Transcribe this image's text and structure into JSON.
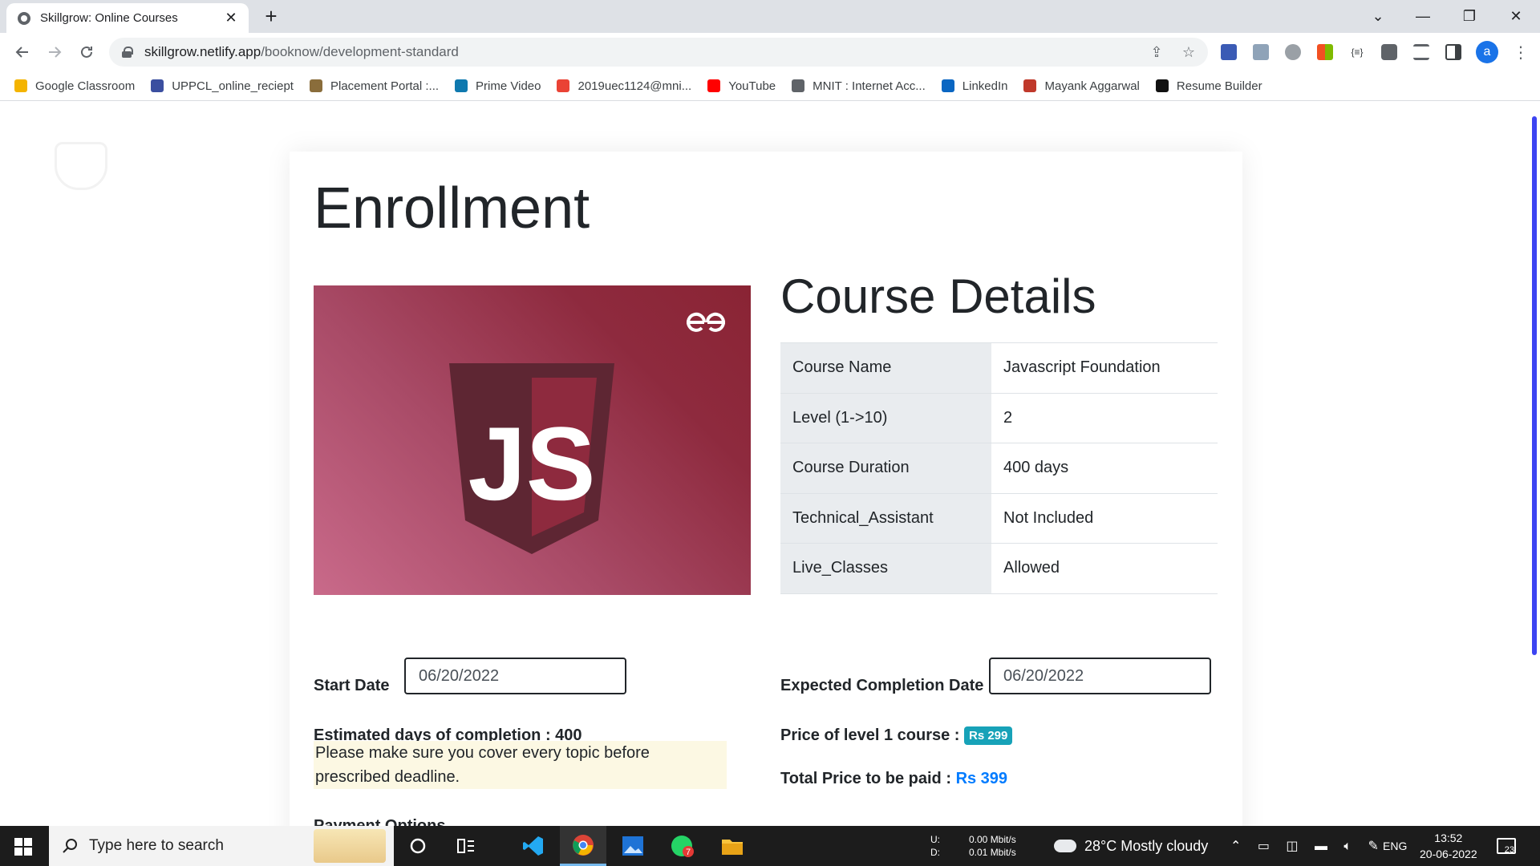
{
  "browser": {
    "tab_title": "Skillgrow: Online Courses",
    "tab_close": "✕",
    "new_tab": "+",
    "url_host": "skillgrow.netlify.app",
    "url_path": "/booknow/development-standard",
    "profile_initial": "a",
    "window_controls": {
      "dropdown": "⌄",
      "minimize": "—",
      "restore": "❐",
      "close": "✕"
    }
  },
  "bookmarks": [
    {
      "label": "Google Classroom",
      "color": "#f4b400"
    },
    {
      "label": "UPPCL_online_reciept",
      "color": "#3b4fa0"
    },
    {
      "label": "Placement Portal :...",
      "color": "#8a6d3b"
    },
    {
      "label": "Prime Video",
      "color": "#0f79af"
    },
    {
      "label": "2019uec1124@mni...",
      "color": "#ea4335"
    },
    {
      "label": "YouTube",
      "color": "#ff0000"
    },
    {
      "label": "MNIT : Internet Acc...",
      "color": "#5f6368"
    },
    {
      "label": "LinkedIn",
      "color": "#0a66c2"
    },
    {
      "label": "Mayank Aggarwal",
      "color": "#c0392b"
    },
    {
      "label": "Resume Builder",
      "color": "#111111"
    }
  ],
  "page": {
    "title": "Enrollment",
    "image_brand": "GfG",
    "image_logo_text": "JS",
    "details_title": "Course Details",
    "details": [
      {
        "key": "Course Name",
        "value": "Javascript Foundation"
      },
      {
        "key": "Level (1->10)",
        "value": "2"
      },
      {
        "key": "Course Duration",
        "value": "400 days"
      },
      {
        "key": "Technical_Assistant",
        "value": "Not Included"
      },
      {
        "key": "Live_Classes",
        "value": "Allowed"
      }
    ],
    "start_date_label": "Start Date",
    "start_date_value": "06/20/2022",
    "completion_label": "Expected Completion Date",
    "completion_value": "06/20/2022",
    "estimated_label": "Estimated days of completion : 400",
    "price_level1_label": "Price of level 1 course :",
    "price_level1_value": "Rs 299",
    "total_label": "Total Price to be paid :",
    "total_value": "Rs 399",
    "notice": "Please make sure you cover every topic before prescribed deadline.",
    "payment_heading": "Payment Options"
  },
  "taskbar": {
    "search_placeholder": "Type here to search",
    "net_up_label": "U:",
    "net_up": "0.00 Mbit/s",
    "net_down_label": "D:",
    "net_down": "0.01 Mbit/s",
    "weather": "28°C  Mostly cloudy",
    "lang": "ENG",
    "time": "13:52",
    "date": "20-06-2022",
    "notifications": "23",
    "whatsapp_badge": "7"
  },
  "colors": {
    "accent_blue": "#007bff",
    "badge_teal": "#17a2b8",
    "notice_bg": "#fcf8e3",
    "table_key_bg": "#e9ecef"
  }
}
